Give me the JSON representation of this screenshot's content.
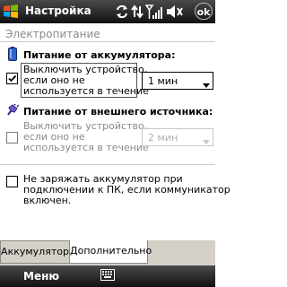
{
  "titlebar": {
    "title": "Настройка",
    "ok_label": "ok",
    "icons": [
      "windows-start-icon",
      "sync-icon",
      "data-connection-icon",
      "signal-strength-icon",
      "volume-icon"
    ]
  },
  "section": {
    "header": "Электропитание"
  },
  "battery_group": {
    "title": "Питание от аккумулятора:",
    "checkbox_checked": true,
    "label_lines": [
      "Выключить устройство,",
      "если оно не",
      "используется в течение"
    ],
    "dropdown_value": "1 мин"
  },
  "external_group": {
    "title": "Питание от внешнего источника:",
    "checkbox_checked": false,
    "label_lines": [
      "Выключить устройство,",
      "если оно не",
      "используется в течение"
    ],
    "dropdown_value": "2 мин"
  },
  "no_charge": {
    "checkbox_checked": false,
    "label_lines": [
      "Не заряжать аккумулятор при",
      "подключении к ПК, если коммуникатор",
      "включен."
    ]
  },
  "tabs": [
    {
      "label": "Аккумулятор",
      "active": false
    },
    {
      "label": "Дополнительно",
      "active": true
    }
  ],
  "menubar": {
    "left_softkey": "Меню"
  }
}
